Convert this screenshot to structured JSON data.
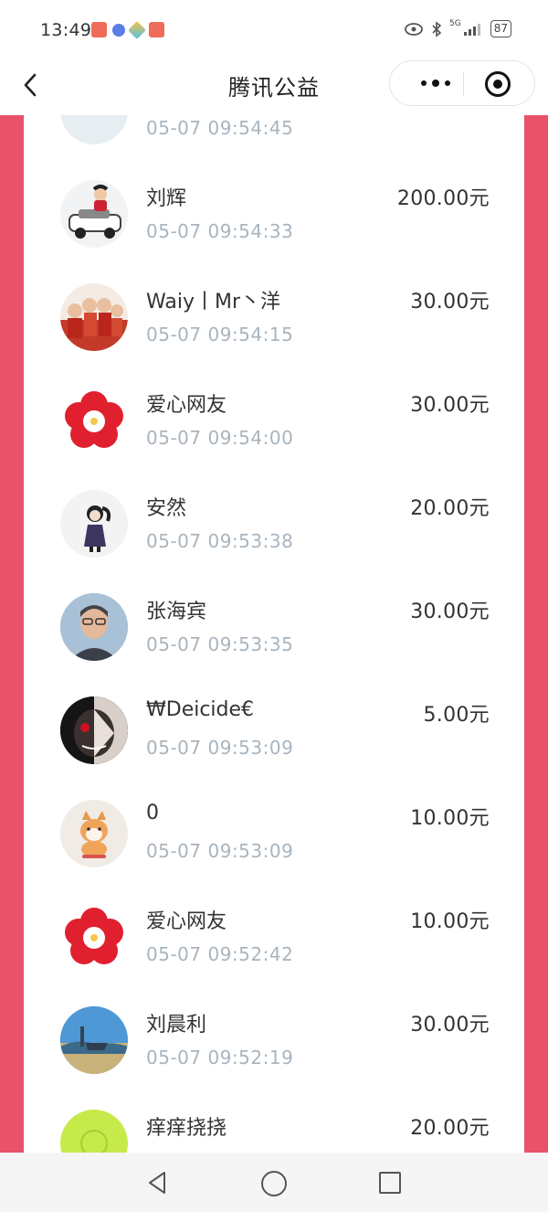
{
  "status": {
    "time": "13:49",
    "battery": "87",
    "network": "5G"
  },
  "nav": {
    "title": "腾讯公益"
  },
  "donations": [
    {
      "name": "",
      "time": "05-07 09:54:45",
      "amount": "",
      "avatar": "avatar-partial-icon"
    },
    {
      "name": "刘辉",
      "time": "05-07 09:54:33",
      "amount": "200.00元",
      "avatar": "car-avatar-icon"
    },
    {
      "name": "Waiy丨Mr丶洋",
      "time": "05-07 09:54:15",
      "amount": "30.00元",
      "avatar": "group-photo-avatar-icon"
    },
    {
      "name": "爱心网友",
      "time": "05-07 09:54:00",
      "amount": "30.00元",
      "avatar": "red-flower-avatar-icon"
    },
    {
      "name": "安然",
      "time": "05-07 09:53:38",
      "amount": "20.00元",
      "avatar": "girl-avatar-icon"
    },
    {
      "name": "张海宾",
      "time": "05-07 09:53:35",
      "amount": "30.00元",
      "avatar": "man-portrait-avatar-icon"
    },
    {
      "name": "₩Deicide€",
      "time": "05-07 09:53:09",
      "amount": "5.00元",
      "avatar": "dark-face-avatar-icon"
    },
    {
      "name": "0",
      "time": "05-07 09:53:09",
      "amount": "10.00元",
      "avatar": "shiba-dog-avatar-icon"
    },
    {
      "name": "爱心网友",
      "time": "05-07 09:52:42",
      "amount": "10.00元",
      "avatar": "red-flower-avatar-icon"
    },
    {
      "name": "刘晨利",
      "time": "05-07 09:52:19",
      "amount": "30.00元",
      "avatar": "landscape-avatar-icon"
    },
    {
      "name": "痒痒挠挠",
      "time": "",
      "amount": "20.00元",
      "avatar": "green-avatar-icon"
    }
  ],
  "colors": {
    "side_accent": "#e8526a",
    "time_text": "#a9b4be",
    "flower_red": "#e0202e"
  }
}
